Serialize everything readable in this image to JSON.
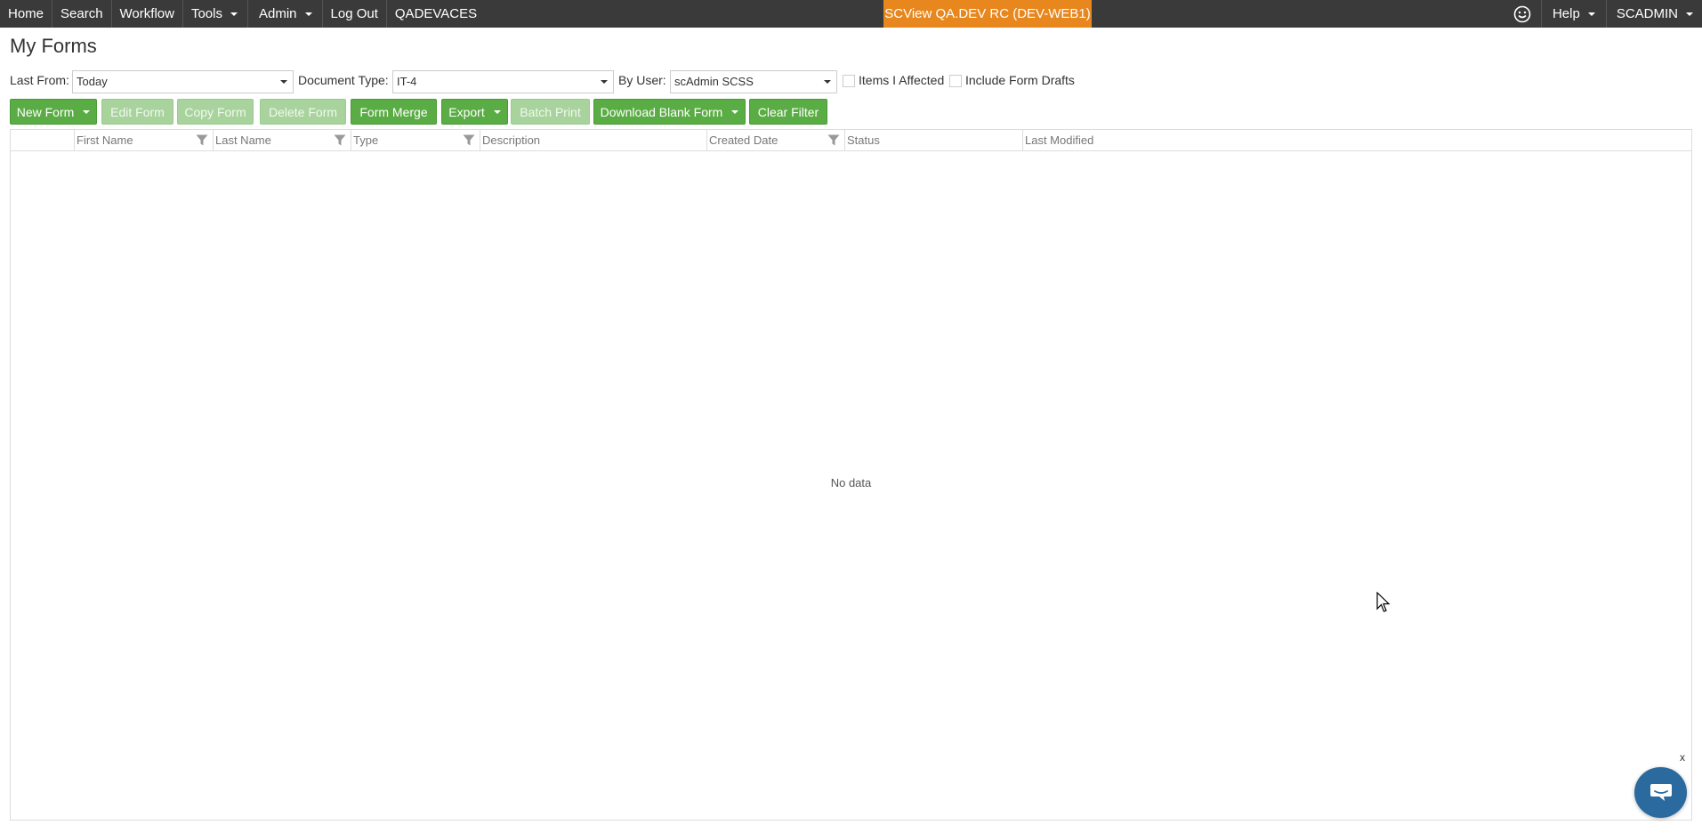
{
  "nav": {
    "items": [
      {
        "label": "Home",
        "dropdown": false
      },
      {
        "label": "Search",
        "dropdown": false
      },
      {
        "label": "Workflow",
        "dropdown": false
      },
      {
        "label": "Tools",
        "dropdown": true
      },
      {
        "label": "Admin",
        "dropdown": true
      },
      {
        "label": "Log Out",
        "dropdown": false
      },
      {
        "label": "QADEVACES",
        "dropdown": false
      }
    ],
    "environment": "SCView QA.DEV RC (DEV-WEB1)",
    "help": "Help",
    "user": "SCADMIN",
    "colors": {
      "bar": "#3a3a3a",
      "environment": "#e8871e"
    }
  },
  "page": {
    "title": "My Forms"
  },
  "filters": {
    "last_from_label": "Last From:",
    "last_from_value": "Today",
    "document_type_label": "Document Type:",
    "document_type_value": "IT-4",
    "by_user_label": "By User:",
    "by_user_value": "scAdmin SCSS",
    "items_affected_label": "Items I Affected",
    "include_drafts_label": "Include Form Drafts"
  },
  "toolbar": {
    "new_form": "New Form",
    "edit_form": "Edit Form",
    "copy_form": "Copy Form",
    "delete_form": "Delete Form",
    "form_merge": "Form Merge",
    "export": "Export",
    "batch_print": "Batch Print",
    "download_blank_form": "Download Blank Form",
    "clear_filter": "Clear Filter",
    "color": "#5aac44"
  },
  "grid": {
    "columns": [
      "First Name",
      "Last Name",
      "Type",
      "Description",
      "Created Date",
      "Status",
      "Last Modified"
    ],
    "empty_text": "No data"
  },
  "chat": {
    "close_label": "x",
    "icon": "chat-icon"
  }
}
